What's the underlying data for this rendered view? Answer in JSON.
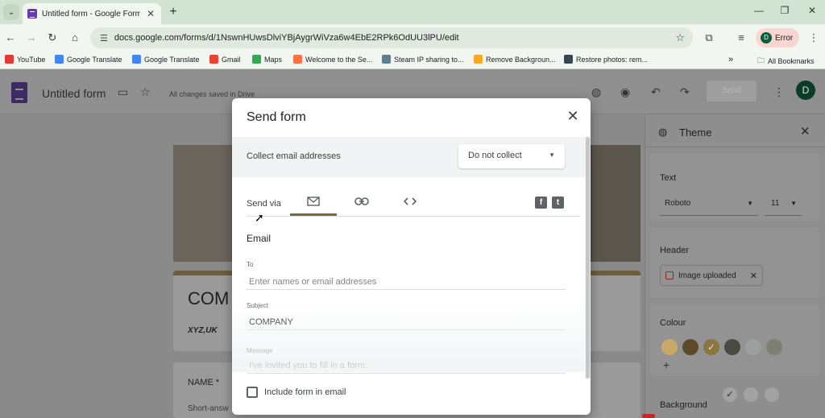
{
  "browser": {
    "tab_title": "Untitled form - Google Forms",
    "url": "docs.google.com/forms/d/1NswnHUwsDlviYBjAygrWiVza6w4EbE2RPk6OdUU3lPU/edit",
    "profile_initial": "D",
    "profile_status": "Error",
    "bookmarks": [
      {
        "label": "YouTube",
        "color": "#e53935"
      },
      {
        "label": "Google Translate",
        "color": "#4285f4"
      },
      {
        "label": "Google Translate",
        "color": "#4285f4"
      },
      {
        "label": "Gmail",
        "color": "#ea4335"
      },
      {
        "label": "Maps",
        "color": "#34a853"
      },
      {
        "label": "Welcome to the Se...",
        "color": "#ff7043"
      },
      {
        "label": "Steam IP sharing to...",
        "color": "#607d8b"
      },
      {
        "label": "Remove Backgroun...",
        "color": "#f9a825"
      },
      {
        "label": "Restore photos: rem...",
        "color": "#37474f"
      }
    ],
    "all_bookmarks": "All Bookmarks"
  },
  "forms": {
    "title": "Untitled form",
    "saved_status": "All changes saved in Drive",
    "send_label": "Send",
    "user_initial": "D",
    "company_title": "COM",
    "company_sub": "XYZ,UK",
    "question_label": "NAME *",
    "question_hint": "Short-answ"
  },
  "theme": {
    "title": "Theme",
    "text_label": "Text",
    "font": "Roboto",
    "font_size": "11",
    "header_label": "Header",
    "header_chip": "Image uploaded",
    "colour_label": "Colour",
    "background_label": "Background",
    "colors": [
      "#c9a86a",
      "#5d4a2a",
      "#8a7440",
      "#4a4a42",
      "#9aa09e",
      "#7c806f"
    ],
    "selected_color_index": 2
  },
  "dialog": {
    "title": "Send form",
    "collect_label": "Collect email addresses",
    "collect_value": "Do not collect",
    "send_via_label": "Send via",
    "section_title": "Email",
    "to_label": "To",
    "to_placeholder": "Enter names or email addresses",
    "subject_label": "Subject",
    "subject_value": "COMPANY",
    "message_label": "Message",
    "message_value": "I've invited you to fill in a form:",
    "include_label": "Include form in email",
    "include_checked": false,
    "accent_color": "#7a6a3e"
  }
}
